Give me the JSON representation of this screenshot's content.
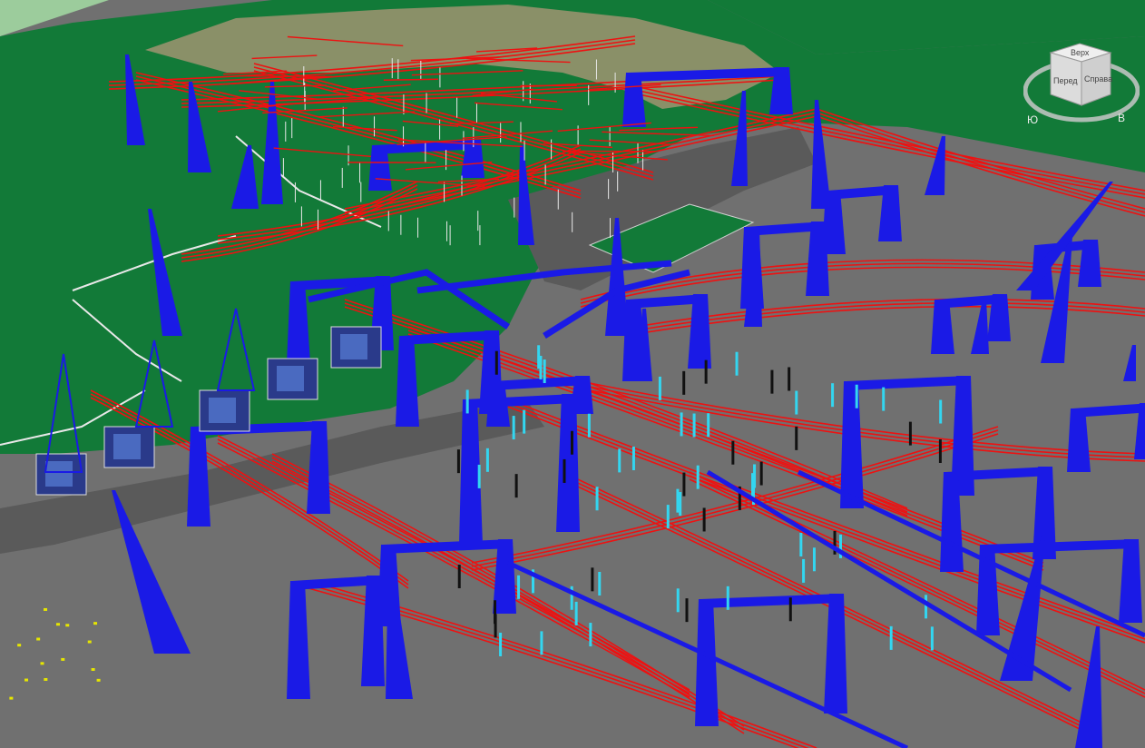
{
  "viewcube": {
    "top_label": "Верх",
    "front_label": "Перед",
    "right_label": "Справа",
    "compass_south": "Ю",
    "compass_east": "В"
  },
  "scene": {
    "colors": {
      "ground": "#707070",
      "grass": "#127a38",
      "sand": "#8a9068",
      "steel": "#1a1ae6",
      "conductor": "#ee1111",
      "fence": "#e8e8e8",
      "insulator": "#33d6f0"
    }
  }
}
